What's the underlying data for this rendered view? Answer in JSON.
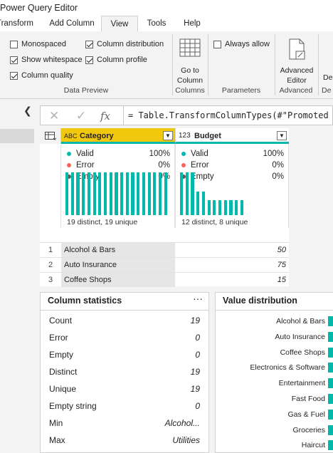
{
  "window": {
    "title": "Power Query Editor"
  },
  "tabs": [
    {
      "label": "Transform",
      "active": false
    },
    {
      "label": "Add Column",
      "active": false
    },
    {
      "label": "View",
      "active": true
    },
    {
      "label": "Tools",
      "active": false
    },
    {
      "label": "Help",
      "active": false
    }
  ],
  "ribbon": {
    "data_preview": {
      "label": "Data Preview",
      "options": [
        {
          "label": "Monospaced",
          "checked": false
        },
        {
          "label": "Column distribution",
          "checked": true
        },
        {
          "label": "Show whitespace",
          "checked": true
        },
        {
          "label": "Column profile",
          "checked": true
        },
        {
          "label": "Column quality",
          "checked": true
        }
      ]
    },
    "columns": {
      "label": "Columns",
      "go_to_column_line1": "Go to",
      "go_to_column_line2": "Column"
    },
    "parameters": {
      "label": "Parameters",
      "always_allow": {
        "label": "Always allow",
        "checked": false
      }
    },
    "advanced": {
      "label": "Advanced",
      "editor_line1": "Advanced",
      "editor_line2": "Editor"
    },
    "cut_group_label": "De",
    "cut_button_label": "De"
  },
  "formula_bar": {
    "cancel_glyph": "✕",
    "commit_glyph": "✓",
    "fx_glyph": "fx",
    "formula": "= Table.TransformColumnTypes(#\"Promoted Head"
  },
  "columns": [
    {
      "name": "Category",
      "type_icon": "ABC",
      "quality": [
        {
          "label": "Valid",
          "percent": "100%",
          "color": "#01b8aa"
        },
        {
          "label": "Error",
          "percent": "0%",
          "color": "#fd625e"
        },
        {
          "label": "Empty",
          "percent": "0%",
          "color": "#605e5c"
        }
      ],
      "distribution_bars": [
        1,
        1,
        1,
        1,
        1,
        1,
        1,
        1,
        1,
        1,
        1,
        1,
        1,
        1,
        1,
        1,
        1,
        1,
        1
      ],
      "summary": "19 distinct, 19 unique"
    },
    {
      "name": "Budget",
      "type_icon": "123",
      "quality": [
        {
          "label": "Valid",
          "percent": "100%",
          "color": "#01b8aa"
        },
        {
          "label": "Error",
          "percent": "0%",
          "color": "#fd625e"
        },
        {
          "label": "Empty",
          "percent": "0%",
          "color": "#605e5c"
        }
      ],
      "distribution_bars": [
        1,
        1,
        1,
        0.55,
        0.55,
        0.35,
        0.35,
        0.35,
        0.35,
        0.35,
        0.35,
        0.35
      ],
      "summary": "12 distinct, 8 unique"
    }
  ],
  "rows": [
    {
      "index": "1",
      "category": "Alcohol & Bars",
      "budget": "50"
    },
    {
      "index": "2",
      "category": "Auto Insurance",
      "budget": "75"
    },
    {
      "index": "3",
      "category": "Coffee Shops",
      "budget": "15"
    }
  ],
  "column_statistics": {
    "title": "Column statistics",
    "more": "···",
    "items": [
      {
        "label": "Count",
        "value": "19"
      },
      {
        "label": "Error",
        "value": "0"
      },
      {
        "label": "Empty",
        "value": "0"
      },
      {
        "label": "Distinct",
        "value": "19"
      },
      {
        "label": "Unique",
        "value": "19"
      },
      {
        "label": "Empty string",
        "value": "0"
      },
      {
        "label": "Min",
        "value": "Alcohol..."
      },
      {
        "label": "Max",
        "value": "Utilities"
      }
    ]
  },
  "value_distribution": {
    "title": "Value distribution",
    "items": [
      "Alcohol & Bars",
      "Auto Insurance",
      "Coffee Shops",
      "Electronics & Software",
      "Entertainment",
      "Fast Food",
      "Gas & Fuel",
      "Groceries",
      "Haircut"
    ]
  },
  "colors": {
    "accent": "#01b8aa",
    "header_highlight": "#f2c80f"
  }
}
